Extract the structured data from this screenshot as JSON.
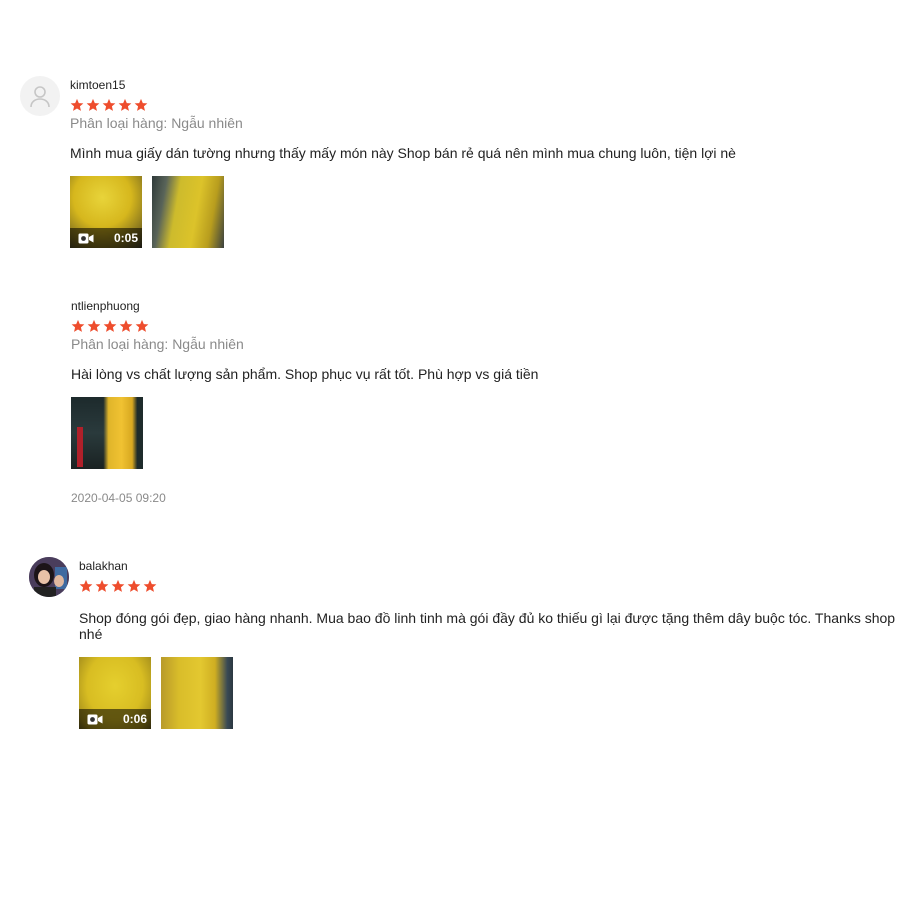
{
  "reviews": [
    {
      "username": "kimtoen15",
      "rating": 5,
      "variation": "Phân loại hàng: Ngẫu nhiên",
      "comment": "Mình mua giấy dán tường nhưng thấy mấy món này Shop bán rẻ quá nên mình mua chung luôn, tiện lợi nè",
      "media": [
        {
          "type": "video",
          "duration": "0:05"
        },
        {
          "type": "image"
        }
      ]
    },
    {
      "username": "ntlienphuong",
      "rating": 5,
      "variation": "Phân loại hàng: Ngẫu nhiên",
      "comment": "Hài lòng vs chất lượng sản phẩm. Shop phục vụ rất tốt. Phù hợp vs giá tiền",
      "media": [
        {
          "type": "image"
        }
      ],
      "timestamp": "2020-04-05 09:20"
    },
    {
      "username": "balakhan",
      "rating": 5,
      "comment": "Shop đóng gói đẹp, giao hàng nhanh. Mua bao đồ linh tinh mà gói đầy đủ ko thiếu gì lại được tặng thêm dây buộc tóc. Thanks shop nhé",
      "media": [
        {
          "type": "video",
          "duration": "0:06"
        },
        {
          "type": "image"
        }
      ]
    }
  ],
  "colors": {
    "star": "#ee4d2d",
    "muted": "#8a8a8a",
    "text": "#222222"
  }
}
